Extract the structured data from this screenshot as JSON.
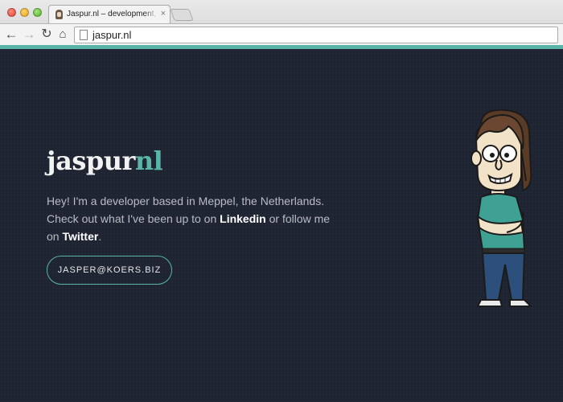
{
  "browser": {
    "tab_title": "Jaspur.nl – development, M",
    "tab_close": "×",
    "url": "jaspur.nl",
    "icons": {
      "back": "back-arrow-icon",
      "forward": "forward-arrow-icon",
      "reload": "reload-icon",
      "home": "home-icon",
      "page": "page-icon"
    }
  },
  "site": {
    "logo_part1": "jaspur",
    "logo_part2": "nl",
    "intro_before": "Hey! I'm a developer based in Meppel, the Netherlands. Check out what I've been up to on ",
    "linkedin": "Linkedin",
    "intro_middle": " or follow me on ",
    "twitter": "Twitter",
    "intro_after": ".",
    "email_button": "JASPER@KOERS.BIZ"
  },
  "colors": {
    "background": "#1f2432",
    "accent": "#5ab5a8",
    "text": "#b9bcc6"
  }
}
